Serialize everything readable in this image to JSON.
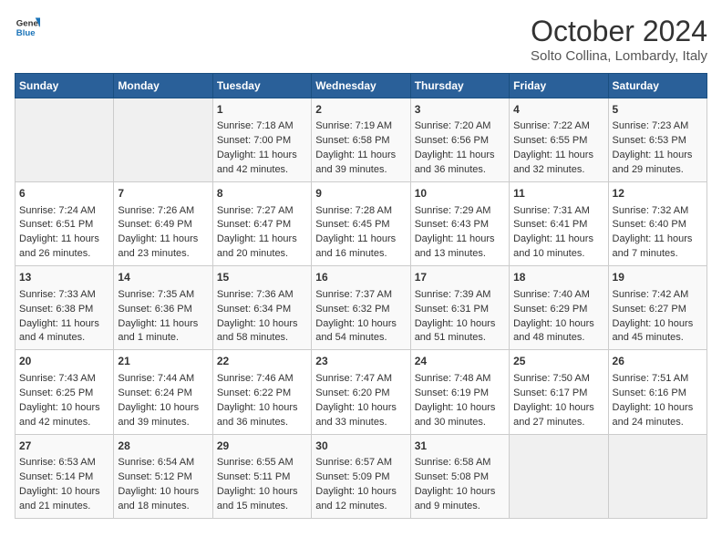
{
  "header": {
    "logo_general": "General",
    "logo_blue": "Blue",
    "title": "October 2024",
    "location": "Solto Collina, Lombardy, Italy"
  },
  "weekdays": [
    "Sunday",
    "Monday",
    "Tuesday",
    "Wednesday",
    "Thursday",
    "Friday",
    "Saturday"
  ],
  "weeks": [
    [
      {
        "day": "",
        "content": ""
      },
      {
        "day": "",
        "content": ""
      },
      {
        "day": "1",
        "content": "Sunrise: 7:18 AM\nSunset: 7:00 PM\nDaylight: 11 hours and 42 minutes."
      },
      {
        "day": "2",
        "content": "Sunrise: 7:19 AM\nSunset: 6:58 PM\nDaylight: 11 hours and 39 minutes."
      },
      {
        "day": "3",
        "content": "Sunrise: 7:20 AM\nSunset: 6:56 PM\nDaylight: 11 hours and 36 minutes."
      },
      {
        "day": "4",
        "content": "Sunrise: 7:22 AM\nSunset: 6:55 PM\nDaylight: 11 hours and 32 minutes."
      },
      {
        "day": "5",
        "content": "Sunrise: 7:23 AM\nSunset: 6:53 PM\nDaylight: 11 hours and 29 minutes."
      }
    ],
    [
      {
        "day": "6",
        "content": "Sunrise: 7:24 AM\nSunset: 6:51 PM\nDaylight: 11 hours and 26 minutes."
      },
      {
        "day": "7",
        "content": "Sunrise: 7:26 AM\nSunset: 6:49 PM\nDaylight: 11 hours and 23 minutes."
      },
      {
        "day": "8",
        "content": "Sunrise: 7:27 AM\nSunset: 6:47 PM\nDaylight: 11 hours and 20 minutes."
      },
      {
        "day": "9",
        "content": "Sunrise: 7:28 AM\nSunset: 6:45 PM\nDaylight: 11 hours and 16 minutes."
      },
      {
        "day": "10",
        "content": "Sunrise: 7:29 AM\nSunset: 6:43 PM\nDaylight: 11 hours and 13 minutes."
      },
      {
        "day": "11",
        "content": "Sunrise: 7:31 AM\nSunset: 6:41 PM\nDaylight: 11 hours and 10 minutes."
      },
      {
        "day": "12",
        "content": "Sunrise: 7:32 AM\nSunset: 6:40 PM\nDaylight: 11 hours and 7 minutes."
      }
    ],
    [
      {
        "day": "13",
        "content": "Sunrise: 7:33 AM\nSunset: 6:38 PM\nDaylight: 11 hours and 4 minutes."
      },
      {
        "day": "14",
        "content": "Sunrise: 7:35 AM\nSunset: 6:36 PM\nDaylight: 11 hours and 1 minute."
      },
      {
        "day": "15",
        "content": "Sunrise: 7:36 AM\nSunset: 6:34 PM\nDaylight: 10 hours and 58 minutes."
      },
      {
        "day": "16",
        "content": "Sunrise: 7:37 AM\nSunset: 6:32 PM\nDaylight: 10 hours and 54 minutes."
      },
      {
        "day": "17",
        "content": "Sunrise: 7:39 AM\nSunset: 6:31 PM\nDaylight: 10 hours and 51 minutes."
      },
      {
        "day": "18",
        "content": "Sunrise: 7:40 AM\nSunset: 6:29 PM\nDaylight: 10 hours and 48 minutes."
      },
      {
        "day": "19",
        "content": "Sunrise: 7:42 AM\nSunset: 6:27 PM\nDaylight: 10 hours and 45 minutes."
      }
    ],
    [
      {
        "day": "20",
        "content": "Sunrise: 7:43 AM\nSunset: 6:25 PM\nDaylight: 10 hours and 42 minutes."
      },
      {
        "day": "21",
        "content": "Sunrise: 7:44 AM\nSunset: 6:24 PM\nDaylight: 10 hours and 39 minutes."
      },
      {
        "day": "22",
        "content": "Sunrise: 7:46 AM\nSunset: 6:22 PM\nDaylight: 10 hours and 36 minutes."
      },
      {
        "day": "23",
        "content": "Sunrise: 7:47 AM\nSunset: 6:20 PM\nDaylight: 10 hours and 33 minutes."
      },
      {
        "day": "24",
        "content": "Sunrise: 7:48 AM\nSunset: 6:19 PM\nDaylight: 10 hours and 30 minutes."
      },
      {
        "day": "25",
        "content": "Sunrise: 7:50 AM\nSunset: 6:17 PM\nDaylight: 10 hours and 27 minutes."
      },
      {
        "day": "26",
        "content": "Sunrise: 7:51 AM\nSunset: 6:16 PM\nDaylight: 10 hours and 24 minutes."
      }
    ],
    [
      {
        "day": "27",
        "content": "Sunrise: 6:53 AM\nSunset: 5:14 PM\nDaylight: 10 hours and 21 minutes."
      },
      {
        "day": "28",
        "content": "Sunrise: 6:54 AM\nSunset: 5:12 PM\nDaylight: 10 hours and 18 minutes."
      },
      {
        "day": "29",
        "content": "Sunrise: 6:55 AM\nSunset: 5:11 PM\nDaylight: 10 hours and 15 minutes."
      },
      {
        "day": "30",
        "content": "Sunrise: 6:57 AM\nSunset: 5:09 PM\nDaylight: 10 hours and 12 minutes."
      },
      {
        "day": "31",
        "content": "Sunrise: 6:58 AM\nSunset: 5:08 PM\nDaylight: 10 hours and 9 minutes."
      },
      {
        "day": "",
        "content": ""
      },
      {
        "day": "",
        "content": ""
      }
    ]
  ]
}
